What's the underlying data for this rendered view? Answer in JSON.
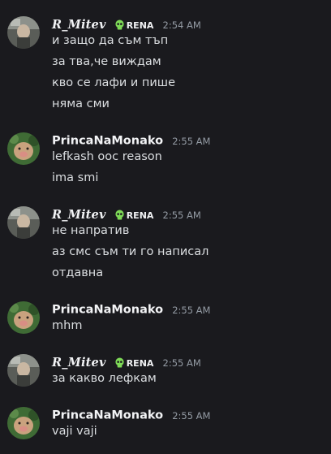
{
  "colors": {
    "background": "#1a1a1e",
    "text": "#dbdee1",
    "username": "#f2f3f5",
    "timestamp": "#949ba4",
    "role_icon": "#7ed957"
  },
  "messages": [
    {
      "author": "R_Mitev",
      "role": "RENA",
      "time": "2:54 AM",
      "lines": [
        "и защо да съм тъп",
        "за тва,че виждам",
        "кво се лафи и пише",
        "няма сми"
      ]
    },
    {
      "author": "PrincaNaMonako",
      "time": "2:55 AM",
      "lines": [
        "lefkash ooc reason",
        "ima smi"
      ]
    },
    {
      "author": "R_Mitev",
      "role": "RENA",
      "time": "2:55 AM",
      "lines": [
        "не напратив",
        "аз смс съм ти го написал",
        "отдавна"
      ]
    },
    {
      "author": "PrincaNaMonako",
      "time": "2:55 AM",
      "lines": [
        "mhm"
      ]
    },
    {
      "author": "R_Mitev",
      "role": "RENA",
      "time": "2:55 AM",
      "lines": [
        "за какво лефкам"
      ]
    },
    {
      "author": "PrincaNaMonako",
      "time": "2:55 AM",
      "lines": [
        "vaji vaji"
      ]
    }
  ]
}
